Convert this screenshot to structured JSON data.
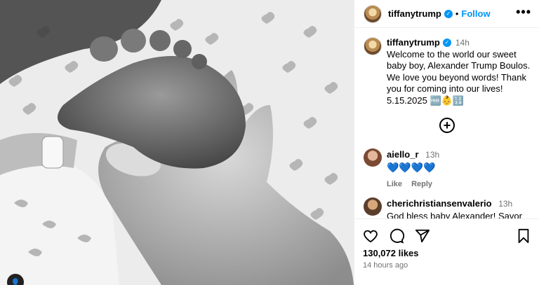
{
  "post": {
    "username": "tiffanytrump",
    "follow_label": "Follow",
    "more_label": "•••",
    "caption_time": "14h",
    "caption": "Welcome to the world our sweet baby boy, Alexander Trump Boulos. We love you beyond words! Thank you for coming into our lives! 5.15.2025 🆓👶🔢",
    "likes": "130,072 likes",
    "posted_ago": "14 hours ago"
  },
  "comments": [
    {
      "username": "aiello_r",
      "time": "13h",
      "text": "💙💙💙💙",
      "like_label": "Like",
      "reply_label": "Reply"
    },
    {
      "username": "cherichristiansenvalerio",
      "time": "13h",
      "text": "God bless baby Alexander! Savor every"
    }
  ],
  "icons": {
    "verified": "verified-icon",
    "more": "more-options-icon",
    "load_more": "add-circle-icon",
    "like": "heart-icon",
    "comment": "comment-icon",
    "share": "share-icon",
    "save": "bookmark-icon"
  },
  "colors": {
    "accent": "#0095f6",
    "secondary_text": "#737373",
    "heart_blue": "#1e6ce0"
  }
}
